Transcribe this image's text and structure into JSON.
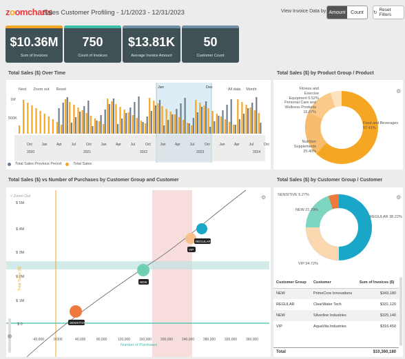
{
  "header": {
    "logo_a": "z",
    "logo_b": "o",
    "logo_c": "omcharts",
    "title": "Sales Customer Profiling - 1/1/2023 - 12/31/2023",
    "view_label": "View Invoice Data by:",
    "toggle": [
      "Amount",
      "Count"
    ],
    "reset_label": "Reset Filters"
  },
  "kpis": [
    {
      "value": "$10.36M",
      "label": "Sum of Invoices",
      "accent": "#f5a623"
    },
    {
      "value": "750",
      "label": "Count of Invoices",
      "accent": "#3bbfa8"
    },
    {
      "value": "$13.81K",
      "label": "Average Invoice Amount",
      "accent": "#6f8fa6"
    },
    {
      "value": "50",
      "label": "Customer Count",
      "accent": "#6f8fa6"
    }
  ],
  "timechart": {
    "title": "Total Sales ($) Over Time",
    "toolbar": [
      "Next",
      "Zoom out",
      "Reset"
    ],
    "toolbar_right": [
      "All data",
      "Month"
    ],
    "y_ticks": [
      "1M",
      "500K",
      "0"
    ],
    "x_months": [
      "Oct",
      "Jan",
      "Apr",
      "Jul",
      "Oct",
      "Jan",
      "Apr",
      "Jul",
      "Oct",
      "Jan",
      "Apr",
      "Jul",
      "Oct",
      "Jan",
      "Apr",
      "Jul",
      "Oct"
    ],
    "years": [
      "2020",
      "2021",
      "2022",
      "2023",
      "2024"
    ],
    "range_labels": [
      "Jan",
      "Dec"
    ],
    "legend": [
      "Total Sales Previous Period",
      "Total Sales"
    ],
    "colors": {
      "current": "#f5a623",
      "previous": "#6f7d8c"
    }
  },
  "donut1": {
    "title": "Total Sales ($) by Product Group / Product",
    "labels": [
      {
        "text": "Fitness and Exercise Equipment 5.52%"
      },
      {
        "text": "Personal Care and Wellness Products 16.67%"
      },
      {
        "text": "Nutrition Supplements 25.40%"
      },
      {
        "text": "Food and Beverages 57.41%"
      }
    ]
  },
  "scatter": {
    "title": "Total Sales ($) vs Number of Purchases by Customer Group and Customer",
    "zoom_label": "Zoom Out",
    "y_axis_title": "Total Sales ($)",
    "x_axis_title": "Number of Purchases",
    "y_ticks": [
      "$ 5M",
      "$ 4M",
      "$ 3M",
      "$ 2M",
      "$ 1M",
      "$ 0"
    ],
    "x_ticks": [
      "-40,000",
      "0.000",
      "40,000",
      "80,000",
      "120,000",
      "160,000",
      "200,000",
      "240,000",
      "280,000",
      "320,000",
      "360,000"
    ],
    "bubbles": [
      {
        "label": "SENSITIVE",
        "color": "#ee7b3d"
      },
      {
        "label": "NEW",
        "color": "#6fd0b1"
      },
      {
        "label": "VIP",
        "color": "#f8c08a"
      },
      {
        "label": "REGULAR",
        "color": "#1aa6c6"
      }
    ]
  },
  "donut2": {
    "title": "Total Sales ($) by Customer Group / Customer",
    "labels": [
      {
        "text": "SENSITIVE 5.27%"
      },
      {
        "text": "NEW 21.79%"
      },
      {
        "text": "REGULAR 38.22%"
      },
      {
        "text": "VIP 34.72%"
      }
    ]
  },
  "table": {
    "headers": [
      "Customer Group",
      "Customer",
      "Sum of Invoices ($)"
    ],
    "rows": [
      [
        "NEW",
        "PrimeCore Innovations",
        "$343,180"
      ],
      [
        "REGULAR",
        "ClearWater Tech",
        "$331,120"
      ],
      [
        "NEW",
        "Silverline Industries",
        "$325,140"
      ],
      [
        "VIP",
        "AquaVita Industries",
        "$316,450"
      ]
    ],
    "total_label": "Total",
    "total_value": "$10,360,180"
  }
}
